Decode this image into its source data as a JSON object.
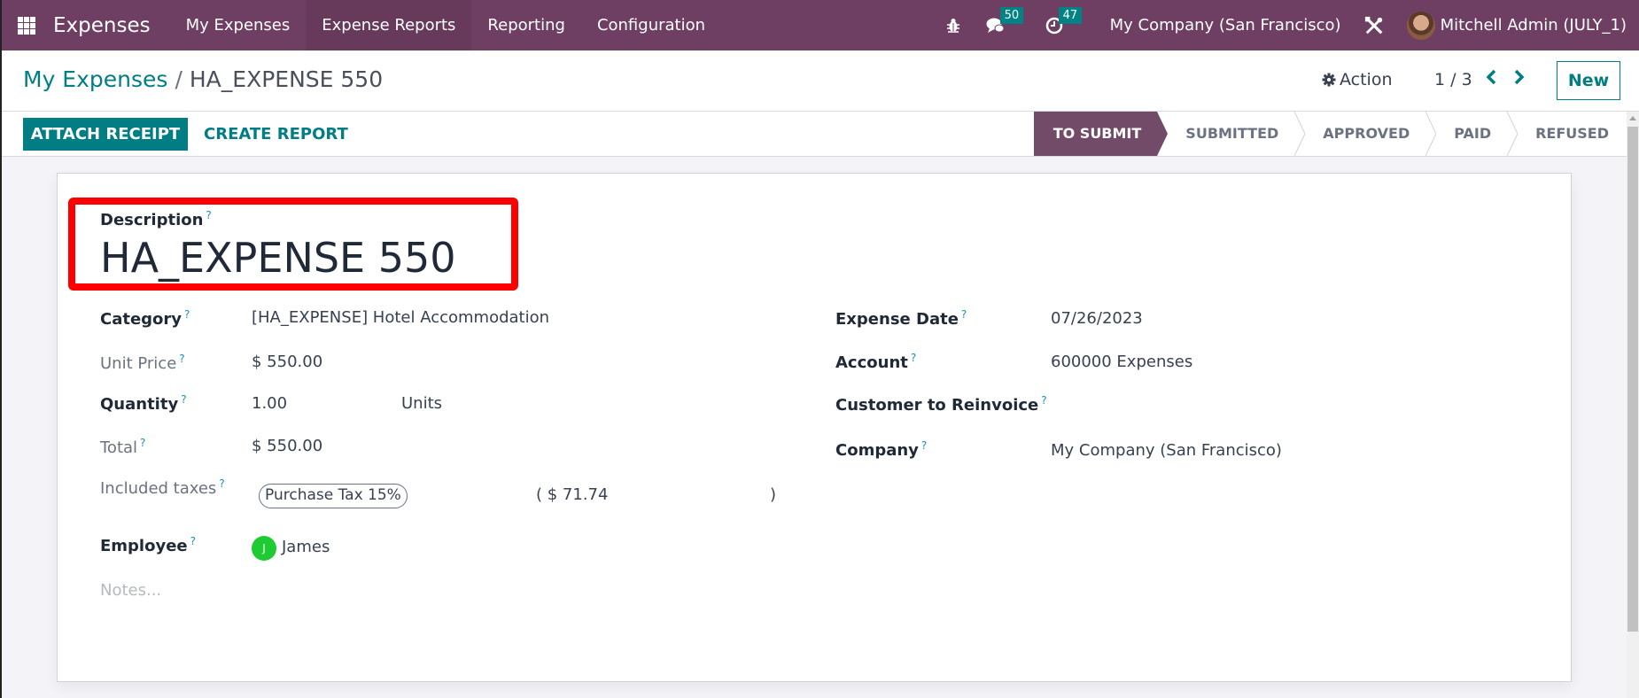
{
  "navbar": {
    "app_name": "Expenses",
    "menu": [
      "My Expenses",
      "Expense Reports",
      "Reporting",
      "Configuration"
    ],
    "active_menu_index": 1,
    "messages_count": "50",
    "activities_count": "47",
    "company": "My Company (San Francisco)",
    "user": "Mitchell Admin (JULY_1)",
    "icons": [
      "apps-grid-icon",
      "bug-icon",
      "chat-icon",
      "clock-icon",
      "tools-icon",
      "user-avatar"
    ]
  },
  "breadcrumb": {
    "parent": "My Expenses",
    "separator": "/",
    "current": "HA_EXPENSE 550"
  },
  "controls": {
    "action_label": "Action",
    "pager": "1 / 3",
    "new_label": "New",
    "attach_receipt_label": "ATTACH RECEIPT",
    "create_report_label": "CREATE REPORT"
  },
  "statusbar": {
    "stages": [
      "TO SUBMIT",
      "SUBMITTED",
      "APPROVED",
      "PAID",
      "REFUSED"
    ],
    "active_index": 0
  },
  "form": {
    "description_label": "Description",
    "description_value": "HA_EXPENSE 550",
    "help_marker": "?",
    "left": {
      "category_label": "Category",
      "category_value": "[HA_EXPENSE] Hotel Accommodation",
      "unit_price_label": "Unit Price",
      "unit_price_value": "$ 550.00",
      "quantity_label": "Quantity",
      "quantity_value": "1.00",
      "quantity_uom": "Units",
      "total_label": "Total",
      "total_value": "$ 550.00",
      "taxes_label": "Included taxes",
      "tax_tag": "Purchase Tax 15%",
      "tax_amount_open": "( $ 71.74",
      "tax_amount_close": ")",
      "employee_label": "Employee",
      "employee_initial": "J",
      "employee_value": "James",
      "notes_placeholder": "Notes..."
    },
    "right": {
      "expense_date_label": "Expense Date",
      "expense_date_value": "07/26/2023",
      "account_label": "Account",
      "account_value": "600000 Expenses",
      "customer_label": "Customer to Reinvoice",
      "customer_value": "",
      "company_label": "Company",
      "company_value": "My Company (San Francisco)"
    }
  },
  "colors": {
    "navbar": "#6f3e63",
    "primary": "#017e84",
    "status_active": "#714b67",
    "highlight_box": "#ff0000",
    "employee_avatar": "#1ecb32"
  }
}
